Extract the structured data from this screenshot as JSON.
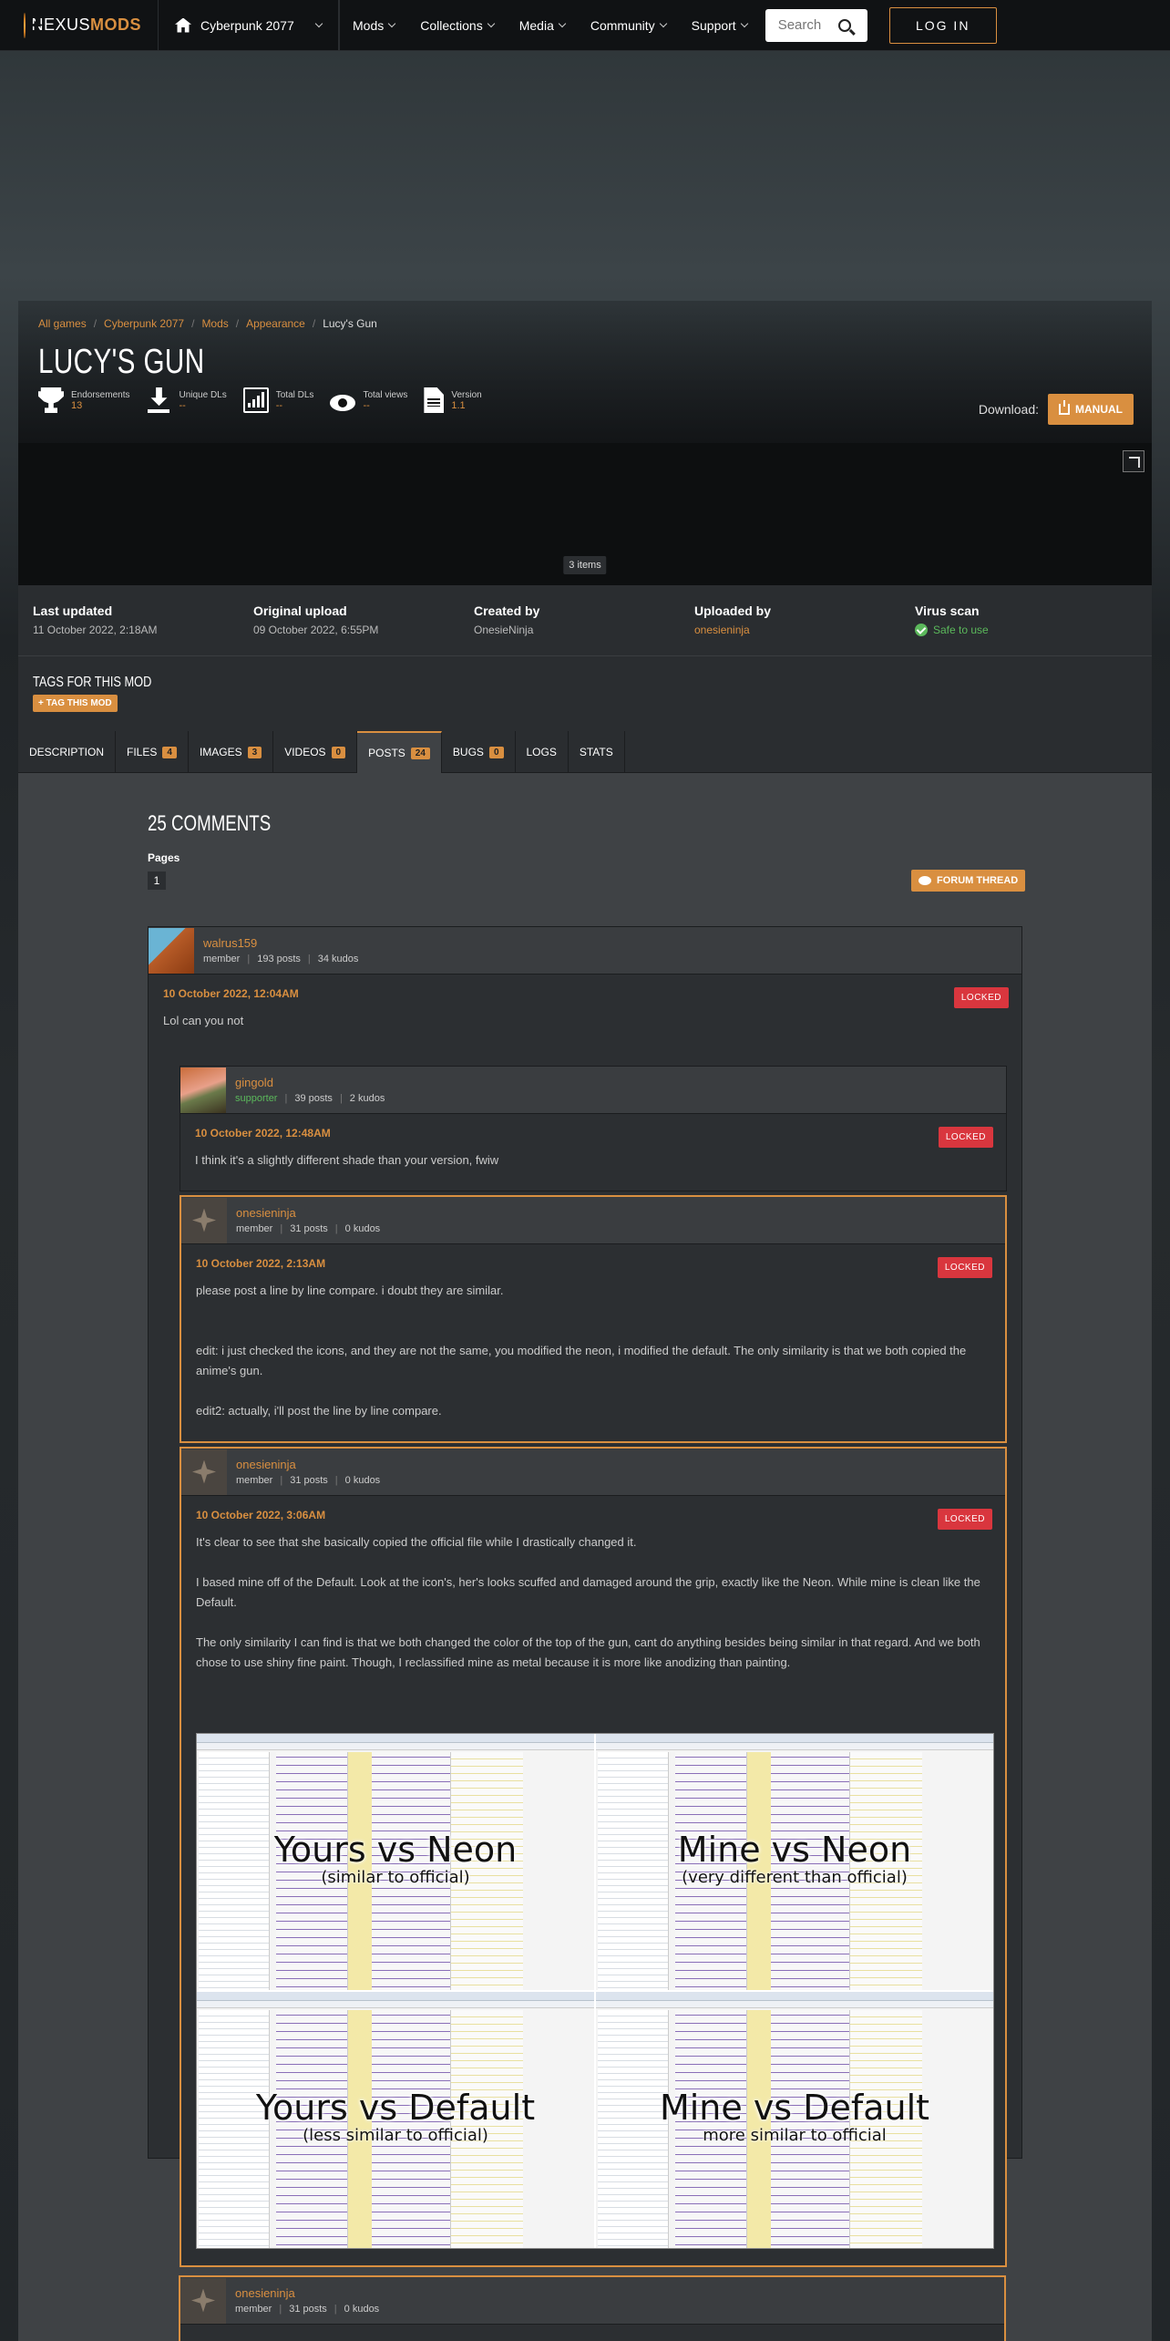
{
  "nav": {
    "logo_prefix": "NEXUS",
    "logo_suffix": "MODS",
    "game": "Cyberpunk 2077",
    "items": [
      "Mods",
      "Collections",
      "Media",
      "Community",
      "Support"
    ],
    "search_placeholder": "Search",
    "login": "LOG IN"
  },
  "breadcrumb": [
    "All games",
    "Cyberpunk 2077",
    "Mods",
    "Appearance",
    "Lucy's Gun"
  ],
  "mod": {
    "title": "LUCY'S GUN",
    "stats": [
      {
        "label": "Endorsements",
        "value": "13"
      },
      {
        "label": "Unique DLs",
        "value": "--"
      },
      {
        "label": "Total DLs",
        "value": "--"
      },
      {
        "label": "Total views",
        "value": "--"
      },
      {
        "label": "Version",
        "value": "1.1"
      }
    ],
    "download_label": "Download:",
    "manual_button": "MANUAL",
    "gallery_count": "3 items"
  },
  "meta": [
    {
      "heading": "Last updated",
      "value": "11 October 2022,  2:18AM"
    },
    {
      "heading": "Original upload",
      "value": "09 October 2022,  6:55PM"
    },
    {
      "heading": "Created by",
      "value": "OnesieNinja"
    },
    {
      "heading": "Uploaded by",
      "value": "onesieninja"
    },
    {
      "heading": "Virus scan",
      "value": "Safe to use"
    }
  ],
  "tags": {
    "heading": "TAGS FOR THIS MOD",
    "button": "TAG THIS MOD"
  },
  "tabs": [
    {
      "label": "DESCRIPTION",
      "badge": ""
    },
    {
      "label": "FILES",
      "badge": "4"
    },
    {
      "label": "IMAGES",
      "badge": "3"
    },
    {
      "label": "VIDEOS",
      "badge": "0"
    },
    {
      "label": "POSTS",
      "badge": "24"
    },
    {
      "label": "BUGS",
      "badge": "0"
    },
    {
      "label": "LOGS",
      "badge": ""
    },
    {
      "label": "STATS",
      "badge": ""
    }
  ],
  "comments_section": {
    "heading": "25 COMMENTS",
    "pages_label": "Pages",
    "page": "1",
    "forum_button": "FORUM THREAD",
    "locked": "LOCKED"
  },
  "comments": [
    {
      "user": "walrus159",
      "role": "member",
      "posts": "193 posts",
      "kudos": "34 kudos",
      "date": "10 October 2022, 12:04AM",
      "text": [
        "Lol can you not"
      ]
    },
    {
      "user": "gingold",
      "role": "supporter",
      "posts": "39 posts",
      "kudos": "2 kudos",
      "date": "10 October 2022, 12:48AM",
      "text": [
        "I think it's a slightly different shade than your version, fwiw"
      ]
    },
    {
      "user": "onesieninja",
      "role": "member",
      "posts": "31 posts",
      "kudos": "0 kudos",
      "date": "10 October 2022, 2:13AM",
      "text": [
        "please post a line by line compare. i doubt they are similar.",
        "edit: i just checked the icons, and they are not the same, you modified the neon, i modified the default. The only similarity is that we both copied the anime's gun.",
        "edit2: actually, i'll post the line by line compare."
      ]
    },
    {
      "user": "onesieninja",
      "role": "member",
      "posts": "31 posts",
      "kudos": "0 kudos",
      "date": "10 October 2022, 3:06AM",
      "text": [
        "It's clear to see that she basically copied the official file while I drastically changed it.",
        "I based mine off of the Default. Look at the icon's, her's looks scuffed and damaged around the grip, exactly like the Neon. While mine is clean like the Default.",
        "The only similarity I can find is that we both changed the color of the top of the gun, cant do anything besides being similar in that regard. And we both chose to use shiny fine paint. Though, I reclassified mine as metal because it is more like anodizing than painting."
      ]
    },
    {
      "user": "onesieninja",
      "role": "member",
      "posts": "31 posts",
      "kudos": "0 kudos",
      "date": "",
      "text": []
    }
  ],
  "comparison_image": [
    {
      "title": "Yours vs Neon",
      "subtitle": "(similar to official)"
    },
    {
      "title": "Mine vs Neon",
      "subtitle": "(very different than official)"
    },
    {
      "title": "Yours vs Default",
      "subtitle": "(less similar to official)"
    },
    {
      "title": "Mine vs Default",
      "subtitle": "more similar to official"
    }
  ],
  "colors": {
    "accent": "#d98f40",
    "locked": "#d9363e",
    "supporter": "#5bb85b"
  }
}
